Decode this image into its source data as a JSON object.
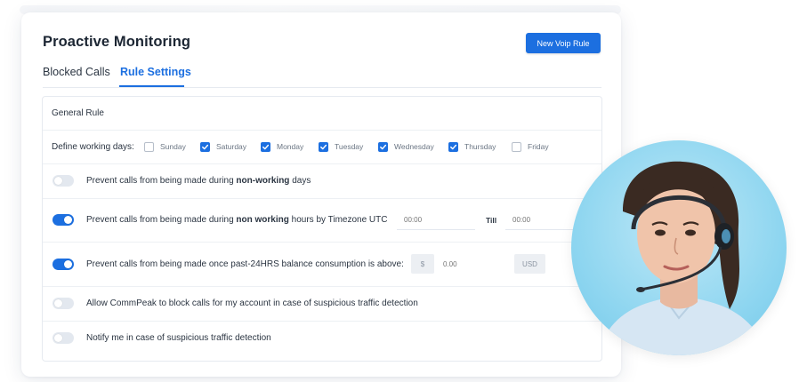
{
  "header": {
    "title": "Proactive Monitoring",
    "new_rule_label": "New Voip Rule"
  },
  "tabs": [
    {
      "label": "Blocked Calls",
      "active": false
    },
    {
      "label": "Rule Settings",
      "active": true
    }
  ],
  "general_rule": {
    "title": "General Rule",
    "working_days_label": "Define working days:",
    "days": [
      {
        "label": "Sunday",
        "checked": false
      },
      {
        "label": "Saturday",
        "checked": true
      },
      {
        "label": "Monday",
        "checked": true
      },
      {
        "label": "Tuesday",
        "checked": true
      },
      {
        "label": "Wednesday",
        "checked": true
      },
      {
        "label": "Thursday",
        "checked": true
      },
      {
        "label": "Friday",
        "checked": false
      }
    ]
  },
  "rules": {
    "non_working_days": {
      "enabled": false,
      "prefix": "Prevent calls from being made during ",
      "bold": "non-working",
      "suffix": " days"
    },
    "non_working_hours": {
      "enabled": true,
      "prefix": "Prevent calls from being made during ",
      "bold": "non working",
      "suffix": " hours by Timezone UTC",
      "from_placeholder": "00:00",
      "till_label": "Till",
      "to_placeholder": "00:00"
    },
    "balance": {
      "enabled": true,
      "text": "Prevent calls from being made once past-24HRS balance consumption is above:",
      "currency_symbol": "$",
      "amount_placeholder": "0.00",
      "currency": "USD"
    },
    "suspicious_block": {
      "enabled": false,
      "text": "Allow CommPeak to block calls for my account in case of suspicious traffic detection"
    },
    "notify": {
      "enabled": false,
      "text": "Notify me in case of suspicious traffic detection"
    }
  },
  "colors": {
    "accent": "#1c6fe0",
    "toggle_off": "#e3e8ef",
    "avatar_bg": "#8fd6f0"
  }
}
